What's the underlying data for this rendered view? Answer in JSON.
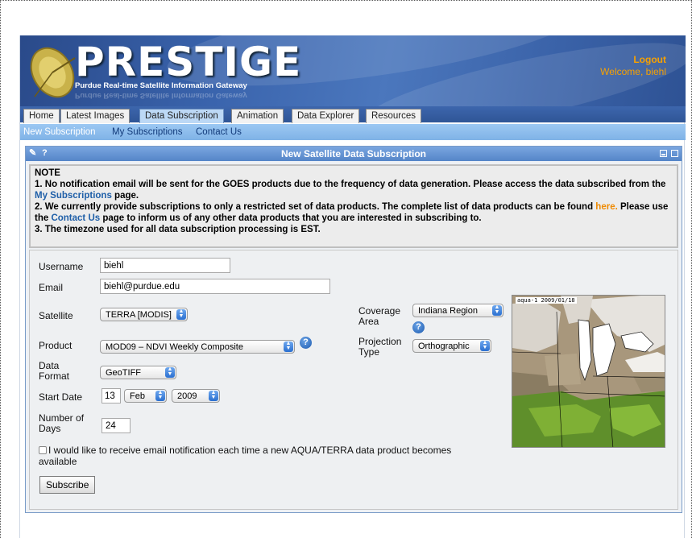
{
  "header": {
    "logo_title": "PRESTIGE",
    "logo_subtitle": "Purdue Real-time Satellite Information Gateway",
    "logout": "Logout",
    "welcome": "Welcome, biehl"
  },
  "tabs": [
    {
      "label": "Home",
      "active": false
    },
    {
      "label": "Latest Images",
      "active": false
    },
    {
      "label": "Data Subscription",
      "active": true
    },
    {
      "label": "Animation",
      "active": false
    },
    {
      "label": "Data Explorer",
      "active": false
    },
    {
      "label": "Resources",
      "active": false
    }
  ],
  "subnav": {
    "current": "New Subscription",
    "items": [
      "My Subscriptions",
      "Contact Us"
    ]
  },
  "panel": {
    "title": "New Satellite Data Subscription",
    "edit_icon": "pencil-icon",
    "help_icon": "question-icon"
  },
  "note": {
    "heading": "NOTE",
    "line1_a": "1. No notification email will be sent for the GOES products due to the frequency of data generation. Please access the data subscribed from the ",
    "line1_link": "My Subscriptions",
    "line1_b": " page.",
    "line2_a": "2. We currently provide subscriptions to only a restricted set of data products. The complete list of data products can be found ",
    "line2_link": "here.",
    "line2_b": " Please use the ",
    "line2_link2": "Contact Us",
    "line2_c": " page to inform us of any other data products that you are interested in subscribing to.",
    "line3": "3. The timezone used for all data subscription processing is EST."
  },
  "form": {
    "username_label": "Username",
    "username_value": "biehl",
    "email_label": "Email",
    "email_value": "biehl@purdue.edu",
    "satellite_label": "Satellite",
    "satellite_value": "TERRA [MODIS]",
    "product_label": "Product",
    "product_value": "MOD09 – NDVI Weekly Composite",
    "format_label_1": "Data",
    "format_label_2": "Format",
    "format_value": "GeoTIFF",
    "start_label": "Start Date",
    "start_day": "13",
    "start_month": "Feb",
    "start_year": "2009",
    "days_label_1": "Number of",
    "days_label_2": "Days",
    "days_value": "24",
    "coverage_label_1": "Coverage",
    "coverage_label_2": "Area",
    "coverage_value": "Indiana Region",
    "projection_label_1": "Projection",
    "projection_label_2": "Type",
    "projection_value": "Orthographic",
    "notify_label_1": "I would like to receive email notification each time a new AQUA/TERRA data product becomes",
    "notify_label_2": "available",
    "notify_checked": false,
    "subscribe_button": "Subscribe",
    "map_label": "aqua-1 2009/01/18"
  },
  "colors": {
    "accent_orange": "#f7a100",
    "link_blue": "#1f5fa8",
    "banner_blue": "#3a64ad"
  }
}
